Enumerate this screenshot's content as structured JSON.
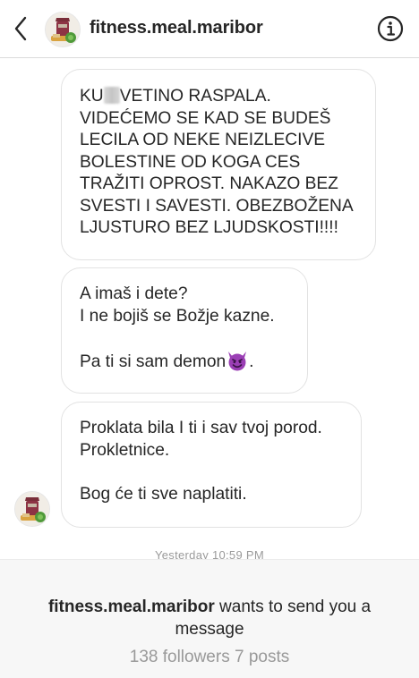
{
  "header": {
    "username": "fitness.meal.maribor"
  },
  "messages": [
    {
      "lines": [
        {
          "before": "KU",
          "after": "VETINO RASPALA."
        },
        {
          "text": "VIDEĆEMO SE KAD SE BUDEŠ"
        },
        {
          "text": "LECILA OD NEKE NEIZLECIVE"
        },
        {
          "text": "BOLESTINE OD KOGA CES"
        },
        {
          "text": "TRAŽITI OPROST. NAKAZO BEZ"
        },
        {
          "text": "SVESTI I SAVESTI. OBEZBOŽENA"
        },
        {
          "text": "LJUSTURO BEZ LJUDSKOSTI!!!!"
        }
      ]
    },
    {
      "lines": [
        {
          "text": "A imaš i dete?"
        },
        {
          "text": "I ne bojiš se Božje kazne."
        },
        {
          "text": ""
        },
        {
          "before": "Pa ti si sam demon",
          "after": "."
        }
      ]
    },
    {
      "lines": [
        {
          "text": "Proklata bila I ti i sav tvoj porod."
        },
        {
          "text": "Prokletnice."
        },
        {
          "text": ""
        },
        {
          "text": "Bog će ti sve naplatiti."
        }
      ]
    }
  ],
  "timestamp": "Yesterday 10:59 PM",
  "request": {
    "username": "fitness.meal.maribor",
    "message_rest": " wants to send you a message",
    "stats": "138 followers 7 posts"
  },
  "colors": {
    "bubble_border": "#e2e2e2",
    "text": "#262626",
    "muted": "#999999",
    "panel_bg": "#f7f7f7",
    "devil_purple": "#9b3fb5"
  },
  "icons": {
    "back": "chevron-left-icon",
    "info": "info-icon",
    "devil": "smiling-devil-emoji"
  }
}
